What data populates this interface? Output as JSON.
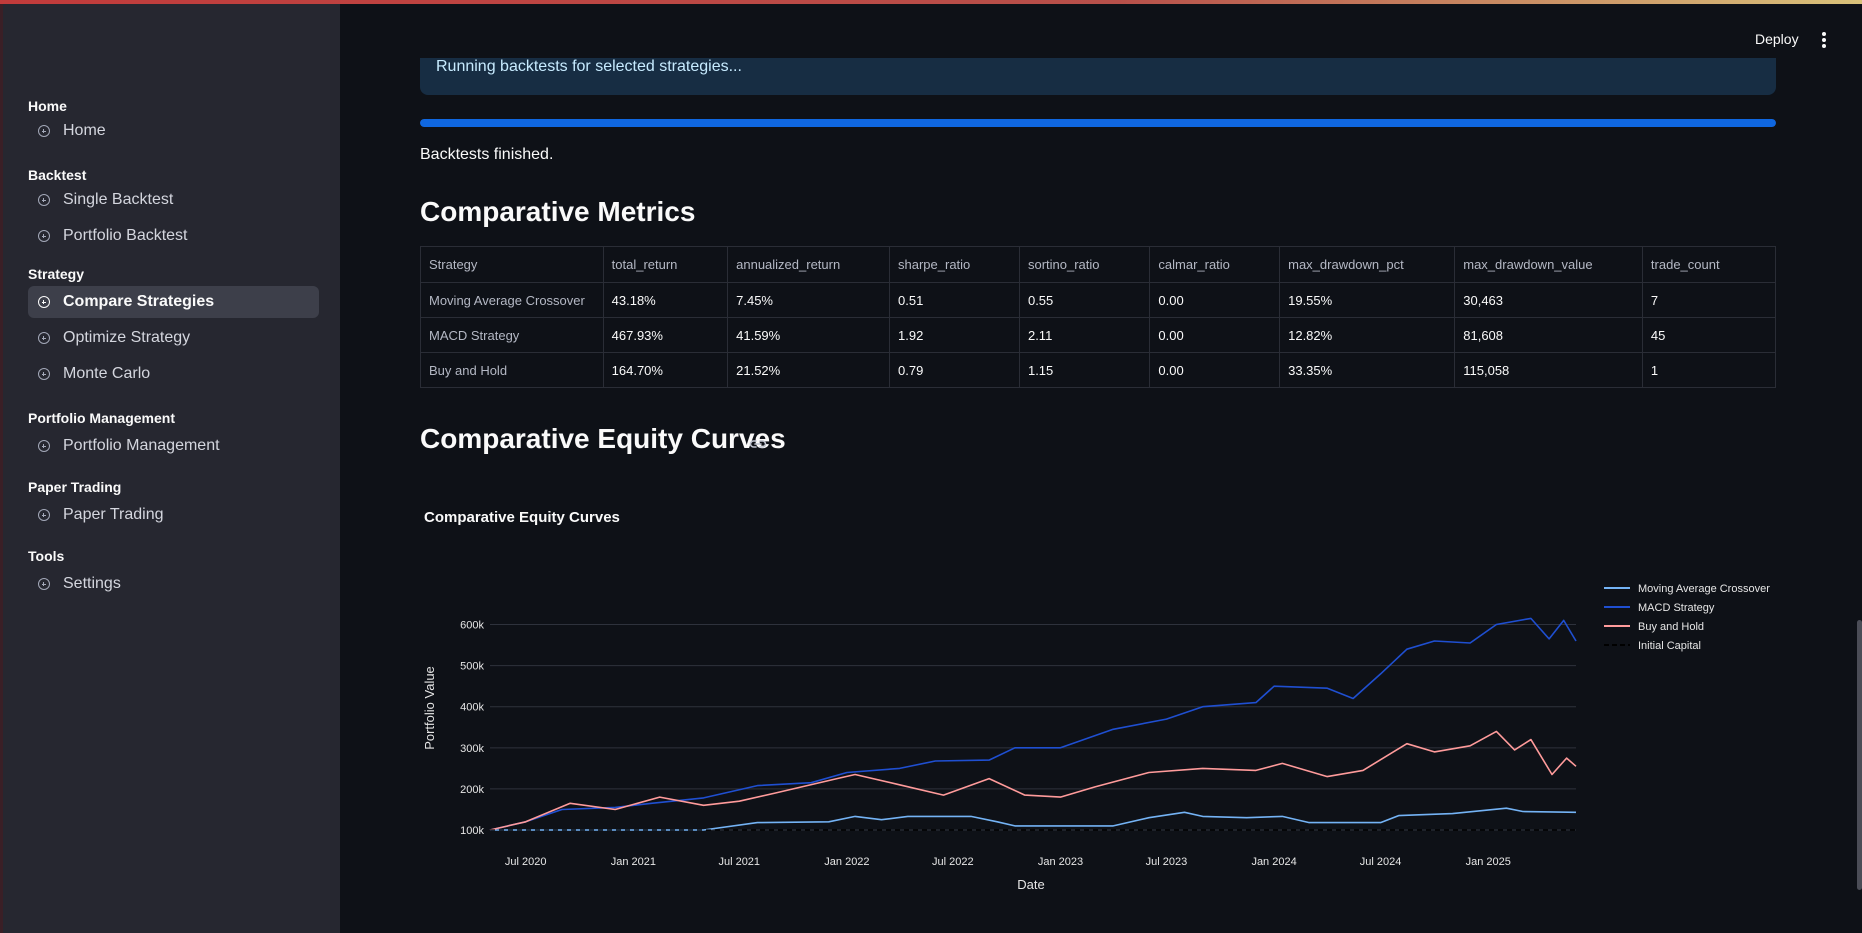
{
  "header": {
    "deploy_label": "Deploy"
  },
  "icons": {
    "menu": "kebab-menu-icon",
    "nav": "circle-plus-icon",
    "anchor": "link-icon"
  },
  "sidebar": {
    "sections": [
      {
        "title": "Home",
        "items": [
          {
            "label": "Home",
            "active": false
          }
        ]
      },
      {
        "title": "Backtest",
        "items": [
          {
            "label": "Single Backtest",
            "active": false
          },
          {
            "label": "Portfolio Backtest",
            "active": false
          }
        ]
      },
      {
        "title": "Strategy",
        "items": [
          {
            "label": "Compare Strategies",
            "active": true
          },
          {
            "label": "Optimize Strategy",
            "active": false
          },
          {
            "label": "Monte Carlo",
            "active": false
          }
        ]
      },
      {
        "title": "Portfolio Management",
        "items": [
          {
            "label": "Portfolio Management",
            "active": false
          }
        ]
      },
      {
        "title": "Paper Trading",
        "items": [
          {
            "label": "Paper Trading",
            "active": false
          }
        ]
      },
      {
        "title": "Tools",
        "items": [
          {
            "label": "Settings",
            "active": false
          }
        ]
      }
    ]
  },
  "main": {
    "info_text": "Running backtests for selected strategies...",
    "progress": 1.0,
    "finished_text": "Backtests finished.",
    "metrics_heading": "Comparative Metrics",
    "metrics_table": {
      "columns": [
        "Strategy",
        "total_return",
        "annualized_return",
        "sharpe_ratio",
        "sortino_ratio",
        "calmar_ratio",
        "max_drawdown_pct",
        "max_drawdown_value",
        "trade_count"
      ],
      "rows": [
        [
          "Moving Average Crossover",
          "43.18%",
          "7.45%",
          "0.51",
          "0.55",
          "0.00",
          "19.55%",
          "30,463",
          "7"
        ],
        [
          "MACD Strategy",
          "467.93%",
          "41.59%",
          "1.92",
          "2.11",
          "0.00",
          "12.82%",
          "81,608",
          "45"
        ],
        [
          "Buy and Hold",
          "164.70%",
          "21.52%",
          "0.79",
          "1.15",
          "0.00",
          "33.35%",
          "115,058",
          "1"
        ]
      ]
    },
    "equity_heading": "Comparative Equity Curves"
  },
  "colors": {
    "accent": "#0f67e0",
    "ma": "#74b3f5",
    "macd": "#1f4fd1",
    "bh": "#ff9b9b",
    "capital": "#000000"
  },
  "chart_data": {
    "type": "line",
    "title": "Comparative Equity Curves",
    "xlabel": "Date",
    "ylabel": "Portfolio Value",
    "x_ticks": [
      "Jul 2020",
      "Jan 2021",
      "Jul 2021",
      "Jan 2022",
      "Jul 2022",
      "Jan 2023",
      "Jul 2023",
      "Jan 2024",
      "Jul 2024",
      "Jan 2025"
    ],
    "y_ticks": [
      "100k",
      "200k",
      "300k",
      "400k",
      "500k",
      "600k"
    ],
    "ylim": [
      100000,
      650000
    ],
    "xlim": [
      "2020-05-01",
      "2025-05-31"
    ],
    "grid": true,
    "legend_position": "right",
    "series": [
      {
        "name": "Moving Average Crossover",
        "color": "#74b3f5",
        "dash": false,
        "points": [
          [
            "2020-05-01",
            100000
          ],
          [
            "2021-01-01",
            100000
          ],
          [
            "2021-05-01",
            100000
          ],
          [
            "2021-08-01",
            118000
          ],
          [
            "2021-12-01",
            120000
          ],
          [
            "2022-01-15",
            133000
          ],
          [
            "2022-03-01",
            125000
          ],
          [
            "2022-04-15",
            133000
          ],
          [
            "2022-08-01",
            133000
          ],
          [
            "2022-09-15",
            120000
          ],
          [
            "2022-10-15",
            110000
          ],
          [
            "2023-04-01",
            110000
          ],
          [
            "2023-06-01",
            130000
          ],
          [
            "2023-08-01",
            143000
          ],
          [
            "2023-09-01",
            133000
          ],
          [
            "2023-11-15",
            130000
          ],
          [
            "2024-01-15",
            133000
          ],
          [
            "2024-03-01",
            118000
          ],
          [
            "2024-07-01",
            118000
          ],
          [
            "2024-08-01",
            135000
          ],
          [
            "2024-11-01",
            140000
          ],
          [
            "2025-02-01",
            153000
          ],
          [
            "2025-03-01",
            145000
          ],
          [
            "2025-05-31",
            143000
          ]
        ]
      },
      {
        "name": "MACD Strategy",
        "color": "#1f4fd1",
        "dash": false,
        "points": [
          [
            "2020-05-01",
            100000
          ],
          [
            "2020-07-01",
            120000
          ],
          [
            "2020-09-01",
            150000
          ],
          [
            "2020-12-01",
            155000
          ],
          [
            "2021-02-01",
            165000
          ],
          [
            "2021-05-01",
            178000
          ],
          [
            "2021-08-01",
            208000
          ],
          [
            "2021-11-01",
            215000
          ],
          [
            "2022-01-01",
            240000
          ],
          [
            "2022-04-01",
            250000
          ],
          [
            "2022-06-01",
            268000
          ],
          [
            "2022-09-01",
            270000
          ],
          [
            "2022-10-15",
            300000
          ],
          [
            "2023-01-01",
            300000
          ],
          [
            "2023-04-01",
            345000
          ],
          [
            "2023-07-01",
            370000
          ],
          [
            "2023-09-01",
            400000
          ],
          [
            "2023-12-01",
            410000
          ],
          [
            "2024-01-01",
            450000
          ],
          [
            "2024-04-01",
            445000
          ],
          [
            "2024-05-15",
            420000
          ],
          [
            "2024-07-01",
            480000
          ],
          [
            "2024-08-15",
            540000
          ],
          [
            "2024-10-01",
            560000
          ],
          [
            "2024-12-01",
            555000
          ],
          [
            "2025-01-15",
            600000
          ],
          [
            "2025-03-15",
            615000
          ],
          [
            "2025-04-15",
            565000
          ],
          [
            "2025-05-10",
            610000
          ],
          [
            "2025-05-31",
            560000
          ]
        ]
      },
      {
        "name": "Buy and Hold",
        "color": "#ff9b9b",
        "dash": false,
        "points": [
          [
            "2020-05-01",
            100000
          ],
          [
            "2020-07-01",
            120000
          ],
          [
            "2020-09-15",
            165000
          ],
          [
            "2020-12-01",
            150000
          ],
          [
            "2021-02-15",
            180000
          ],
          [
            "2021-05-01",
            160000
          ],
          [
            "2021-07-01",
            170000
          ],
          [
            "2021-09-01",
            190000
          ],
          [
            "2021-12-15",
            225000
          ],
          [
            "2022-01-15",
            235000
          ],
          [
            "2022-04-01",
            210000
          ],
          [
            "2022-06-15",
            185000
          ],
          [
            "2022-09-01",
            225000
          ],
          [
            "2022-11-01",
            185000
          ],
          [
            "2023-01-01",
            180000
          ],
          [
            "2023-03-01",
            205000
          ],
          [
            "2023-06-01",
            240000
          ],
          [
            "2023-09-01",
            250000
          ],
          [
            "2023-12-01",
            245000
          ],
          [
            "2024-01-15",
            262000
          ],
          [
            "2024-04-01",
            230000
          ],
          [
            "2024-06-01",
            245000
          ],
          [
            "2024-08-15",
            310000
          ],
          [
            "2024-10-01",
            290000
          ],
          [
            "2024-12-01",
            305000
          ],
          [
            "2025-01-15",
            340000
          ],
          [
            "2025-02-15",
            295000
          ],
          [
            "2025-03-15",
            320000
          ],
          [
            "2025-04-20",
            235000
          ],
          [
            "2025-05-15",
            275000
          ],
          [
            "2025-05-31",
            255000
          ]
        ]
      },
      {
        "name": "Initial Capital",
        "color": "#000000",
        "dash": true,
        "points": [
          [
            "2020-05-01",
            100000
          ],
          [
            "2025-05-31",
            100000
          ]
        ]
      }
    ]
  }
}
